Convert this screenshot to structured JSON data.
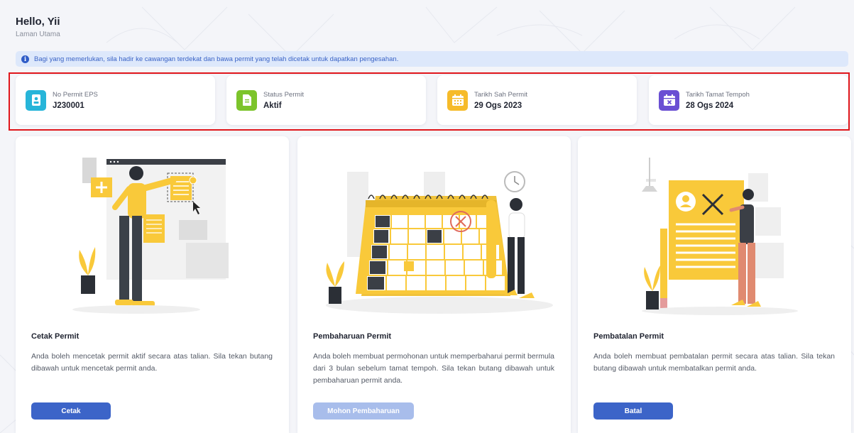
{
  "header": {
    "greeting": "Hello, Yii",
    "subtitle": "Laman Utama"
  },
  "alert": {
    "icon": "info-icon",
    "icon_glyph": "i",
    "text": "Bagi yang memerlukan, sila hadir ke cawangan terdekat dan bawa permit yang telah dicetak untuk dapatkan pengesahan."
  },
  "stats": [
    {
      "label": "No Permit EPS",
      "value": "J230001",
      "icon": "id-card-icon",
      "color": "#27b5d9"
    },
    {
      "label": "Status Permit",
      "value": "Aktif",
      "icon": "document-icon",
      "color": "#7cc42b"
    },
    {
      "label": "Tarikh Sah Permit",
      "value": "29 Ogs 2023",
      "icon": "calendar-icon",
      "color": "#f6bb2a"
    },
    {
      "label": "Tarikh Tamat Tempoh",
      "value": "28 Ogs 2024",
      "icon": "calendar-x-icon",
      "color": "#6a4fd3"
    }
  ],
  "cards": [
    {
      "title": "Cetak Permit",
      "description": "Anda boleh mencetak permit aktif secara atas talian. Sila tekan butang dibawah untuk mencetak permit anda.",
      "button": "Cetak",
      "button_enabled": true
    },
    {
      "title": "Pembaharuan Permit",
      "description": "Anda boleh membuat permohonan untuk memperbaharui permit bermula dari 3 bulan sebelum tamat tempoh. Sila tekan butang dibawah untuk pembaharuan permit anda.",
      "button": "Mohon Pembaharuan",
      "button_enabled": false
    },
    {
      "title": "Pembatalan Permit",
      "description": "Anda boleh membuat pembatalan permit secara atas talian. Sila tekan butang dibawah untuk membatalkan permit anda.",
      "button": "Batal",
      "button_enabled": true
    }
  ],
  "colors": {
    "primary": "#3c64c8",
    "primary_disabled": "#a8bdeb",
    "illustration_yellow": "#f9c93a",
    "highlight_border": "#e0161b"
  }
}
